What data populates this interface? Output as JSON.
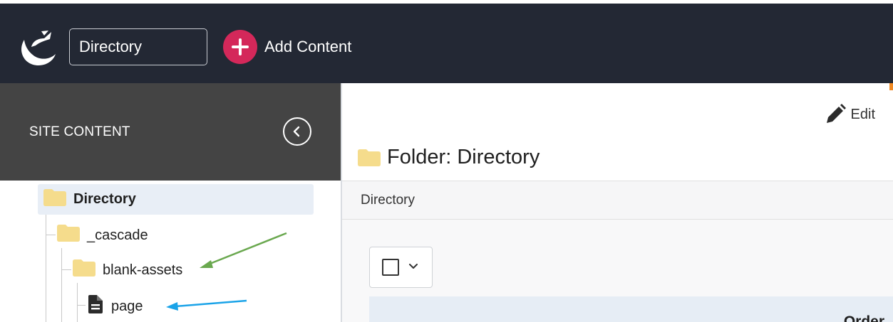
{
  "topbar": {
    "logo_icon": "crescent-bird-logo-icon",
    "site_select_value": "Directory",
    "add_content_label": "Add Content",
    "add_icon": "plus-circle-icon",
    "colors": {
      "background": "#232834",
      "add_button": "#d4285a"
    }
  },
  "sidebar": {
    "title": "SITE CONTENT",
    "collapse_icon": "chevron-left-circle-icon",
    "tree": [
      {
        "label": "Directory",
        "type": "folder",
        "level": 0,
        "selected": true
      },
      {
        "label": "_cascade",
        "type": "folder",
        "level": 1
      },
      {
        "label": "blank-assets",
        "type": "folder",
        "level": 2
      },
      {
        "label": "page",
        "type": "page",
        "level": 3
      }
    ]
  },
  "main": {
    "edit_label": "Edit",
    "edit_icon": "pencil-icon",
    "title": "Folder: Directory",
    "title_icon": "folder-icon",
    "breadcrumb": "Directory",
    "select_all_icon": "checkbox-icon",
    "table": {
      "columns": [
        "Order"
      ]
    }
  },
  "annotations": {
    "arrow_colors": {
      "green": "#6aa84f",
      "blue": "#1aa3e8"
    }
  },
  "colors": {
    "folder": "#f5dc8c",
    "selected_row": "#e8eef6",
    "accent_orange": "#f08a24"
  }
}
